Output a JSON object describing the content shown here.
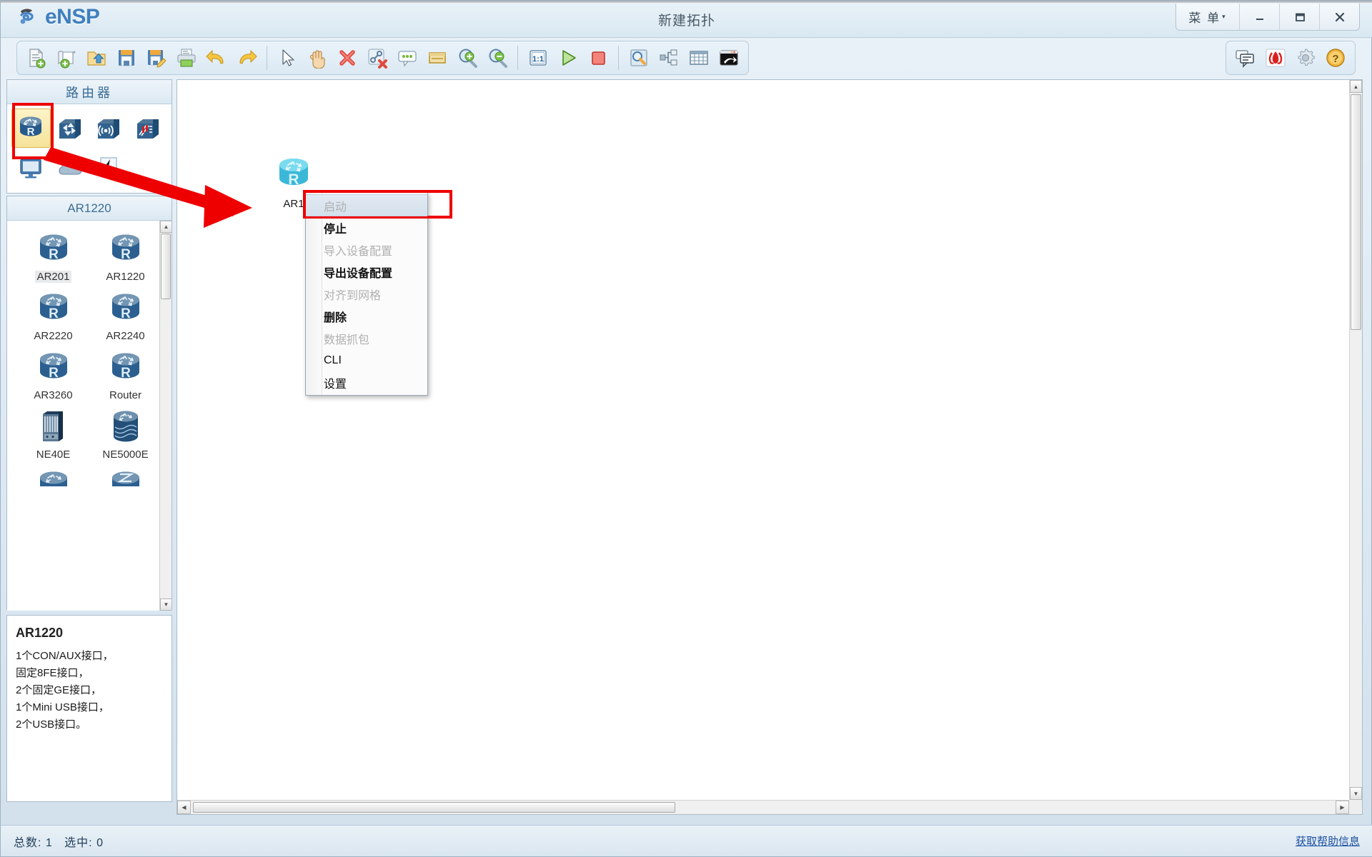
{
  "window": {
    "app_name": "eNSP",
    "title": "新建拓扑",
    "menu_label": "菜 单",
    "menu_caret": "▾",
    "minimize": "—",
    "maximize": "□",
    "close": "✕"
  },
  "toolbar": {
    "left_items": [
      {
        "name": "new-topology-icon",
        "tip": "新建拓扑"
      },
      {
        "name": "new-sheet-icon",
        "tip": "新建试卷"
      },
      {
        "name": "open-folder-icon",
        "tip": "打开"
      },
      {
        "name": "save-icon",
        "tip": "保存"
      },
      {
        "name": "save-as-icon",
        "tip": "另存为"
      },
      {
        "name": "print-icon",
        "tip": "打印"
      },
      {
        "name": "undo-icon",
        "tip": "撤销"
      },
      {
        "name": "redo-icon",
        "tip": "恢复"
      },
      {
        "sep": true
      },
      {
        "name": "select-pointer-icon",
        "tip": "选择"
      },
      {
        "name": "hand-pan-icon",
        "tip": "抓手"
      },
      {
        "name": "delete-x-icon",
        "tip": "删除"
      },
      {
        "name": "delete-link-icon",
        "tip": "删除连线"
      },
      {
        "name": "add-note-icon",
        "tip": "添加文本"
      },
      {
        "name": "add-shape-icon",
        "tip": "添加图形"
      },
      {
        "name": "zoom-in-icon",
        "tip": "放大"
      },
      {
        "name": "zoom-out-icon",
        "tip": "缩小"
      },
      {
        "sep": true
      },
      {
        "name": "zoom-actual-size-icon",
        "tip": "1:1"
      },
      {
        "name": "start-device-icon",
        "tip": "开启设备"
      },
      {
        "name": "stop-device-icon",
        "tip": "关闭设备"
      },
      {
        "sep": true
      },
      {
        "name": "capture-packet-icon",
        "tip": "数据抓包"
      },
      {
        "name": "topology-tree-icon",
        "tip": "拓扑树"
      },
      {
        "name": "grid-icon",
        "tip": "网格"
      },
      {
        "name": "console-icon",
        "tip": "控制台"
      }
    ],
    "right_items": [
      {
        "name": "chat-bubble-icon",
        "tip": "论坛"
      },
      {
        "name": "huawei-logo-icon",
        "tip": "华为"
      },
      {
        "name": "settings-gear-icon",
        "tip": "设置"
      },
      {
        "name": "help-question-icon",
        "tip": "帮助"
      }
    ]
  },
  "sidebar": {
    "category_header": "路由器",
    "categories": [
      {
        "name": "category-router",
        "icon": "router-icon",
        "selected": true
      },
      {
        "name": "category-switch",
        "icon": "switch-icon",
        "selected": false
      },
      {
        "name": "category-wlan",
        "icon": "wireless-ap-icon",
        "selected": false
      },
      {
        "name": "category-firewall",
        "icon": "firewall-icon",
        "selected": false
      },
      {
        "name": "category-endpoint",
        "icon": "monitor-icon",
        "selected": false
      },
      {
        "name": "category-cloud",
        "icon": "cloud-icon",
        "selected": false
      },
      {
        "name": "category-connection",
        "icon": "lightning-icon",
        "selected": false
      }
    ],
    "model_header": "AR1220",
    "devices": [
      {
        "label": "AR201",
        "icon": "router-device-icon",
        "selected": true
      },
      {
        "label": "AR1220",
        "icon": "router-device-icon",
        "selected": false
      },
      {
        "label": "AR2220",
        "icon": "router-device-icon",
        "selected": false
      },
      {
        "label": "AR2240",
        "icon": "router-device-icon",
        "selected": false
      },
      {
        "label": "AR3260",
        "icon": "router-device-icon",
        "selected": false
      },
      {
        "label": "Router",
        "icon": "router-device-icon",
        "selected": false
      },
      {
        "label": "NE40E",
        "icon": "ne-chassis-icon",
        "selected": false
      },
      {
        "label": "NE5000E",
        "icon": "ne-core-icon",
        "selected": false
      }
    ],
    "description": {
      "title": "AR1220",
      "lines": [
        "1个CON/AUX接口，",
        "固定8FE接口，",
        "2个固定GE接口，",
        "1个Mini USB接口，",
        "2个USB接口。"
      ]
    }
  },
  "canvas": {
    "nodes": [
      {
        "label": "AR1",
        "icon": "router-running-icon",
        "x": "132",
        "y": "104"
      }
    ]
  },
  "context_menu": {
    "items": [
      {
        "label": "启动",
        "disabled": true,
        "highlight": true
      },
      {
        "label": "停止",
        "disabled": false,
        "highlight": false
      },
      {
        "label": "导入设备配置",
        "disabled": true,
        "highlight": false
      },
      {
        "label": "导出设备配置",
        "disabled": false,
        "highlight": false
      },
      {
        "label": "对齐到网格",
        "disabled": true,
        "highlight": false
      },
      {
        "label": "删除",
        "disabled": false,
        "highlight": false
      },
      {
        "label": "数据抓包",
        "disabled": true,
        "highlight": false
      },
      {
        "label": "CLI",
        "disabled": false,
        "highlight": false
      },
      {
        "label": "设置",
        "disabled": false,
        "highlight": false
      }
    ]
  },
  "statusbar": {
    "total_label": "总数:",
    "total_value": "1",
    "selected_label": "选中:",
    "selected_value": "0",
    "help_link": "获取帮助信息"
  },
  "annotations": {
    "color": "#ee0000",
    "shapes": [
      {
        "name": "highlight-router-category",
        "type": "rect"
      },
      {
        "name": "arrow-drag-to-canvas",
        "type": "arrow"
      },
      {
        "name": "highlight-start-menu-item",
        "type": "rect"
      }
    ]
  },
  "colors": {
    "accent": "#3f7fbe",
    "panel_border": "#a9bdcd",
    "title_text": "#4a5a68",
    "annotation_red": "#ee0000",
    "selected_yellow": "#f6e39a",
    "link_blue": "#1b4fa0"
  }
}
